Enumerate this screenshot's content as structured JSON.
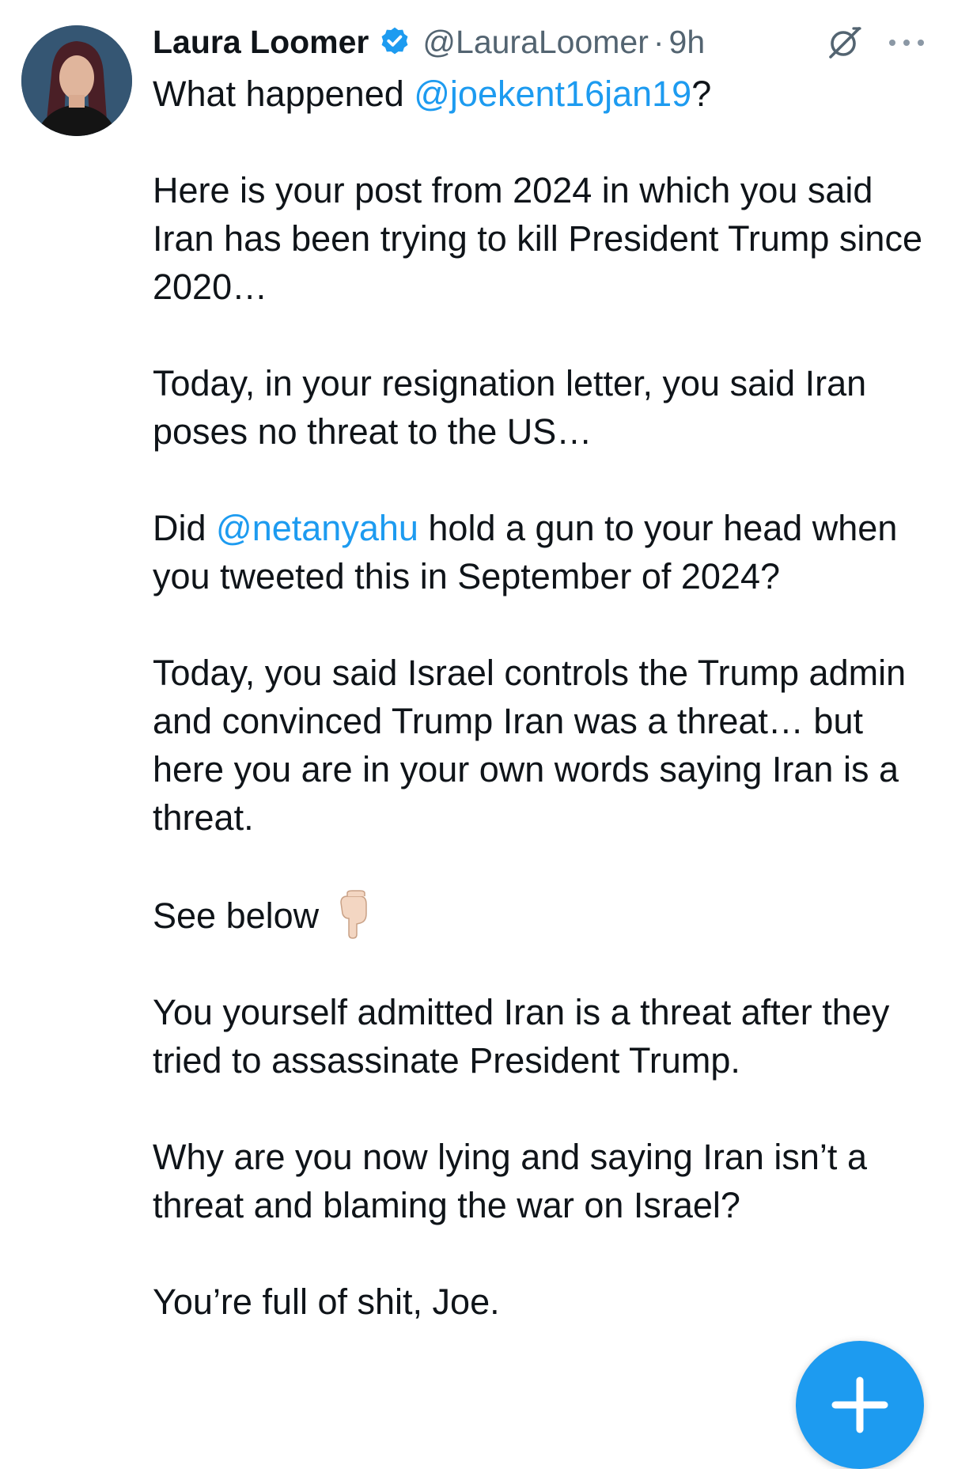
{
  "tweet": {
    "author_name": "Laura Loomer",
    "handle": "@LauraLoomer",
    "separator": "·",
    "time": "9h",
    "paragraphs": [
      {
        "segments": [
          {
            "text": "What happened "
          },
          {
            "text": "@joekent16jan19",
            "mention": true
          },
          {
            "text": "?"
          }
        ]
      },
      {
        "segments": [
          {
            "text": "Here is your post from 2024 in which you said Iran has been trying to kill President Trump since 2020…"
          }
        ]
      },
      {
        "segments": [
          {
            "text": "Today, in your resignation letter, you said Iran poses no threat to the US…"
          }
        ]
      },
      {
        "segments": [
          {
            "text": "Did "
          },
          {
            "text": "@netanyahu",
            "mention": true
          },
          {
            "text": " hold a gun to your head when you tweeted this in September of 2024?"
          }
        ]
      },
      {
        "segments": [
          {
            "text": "Today, you said Israel controls the Trump admin and convinced Trump Iran was a threat… but here you are in your own words saying Iran is a threat."
          }
        ]
      },
      {
        "segments": [
          {
            "text": "See below"
          }
        ],
        "trailing_icon": "pointing-down-hand-icon"
      },
      {
        "segments": [
          {
            "text": "You yourself admitted Iran is a threat after they tried to assassinate President Trump."
          }
        ]
      },
      {
        "segments": [
          {
            "text": "Why are you now lying and saying Iran isn’t a threat and blaming the war on Israel?"
          }
        ]
      },
      {
        "segments": [
          {
            "text": "You’re full of shit, Joe."
          }
        ]
      }
    ]
  },
  "icons": {
    "verified": "verified-badge-icon",
    "grok": "grok-icon",
    "more": "more-options-icon",
    "compose": "compose-plus-icon"
  },
  "colors": {
    "text": "#0f1419",
    "secondary": "#536471",
    "accent": "#1d9bf0"
  }
}
